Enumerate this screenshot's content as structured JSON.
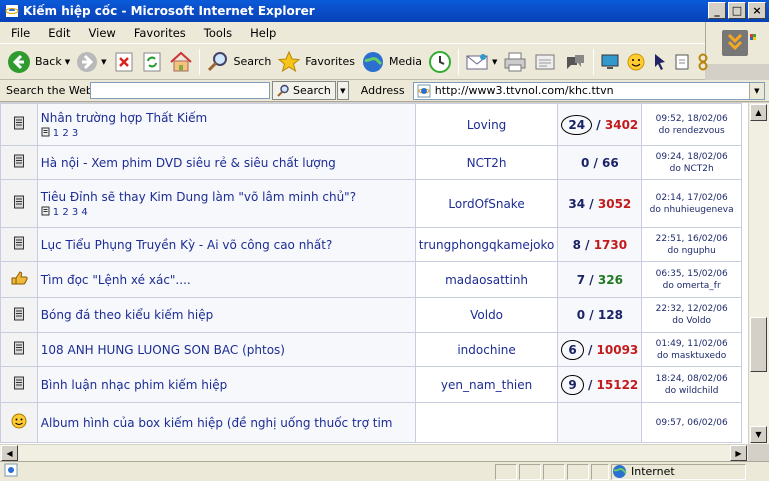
{
  "window": {
    "title": "Kiếm hiệp cốc - Microsoft Internet Explorer",
    "buttons": [
      "_",
      "□",
      "×"
    ]
  },
  "menu": [
    "File",
    "Edit",
    "View",
    "Favorites",
    "Tools",
    "Help"
  ],
  "toolbar": {
    "back_label": "Back",
    "search_label": "Search",
    "favorites_label": "Favorites",
    "media_label": "Media"
  },
  "searchbar": {
    "label": "Search the Web",
    "value": "",
    "go_label": "Search",
    "address_label": "Address",
    "url": "http://www3.ttvnol.com/khc.ttvn"
  },
  "topics": [
    {
      "title": "Nhân trường hợp Thất Kiếm",
      "pages": "1 2 3",
      "author": "Loving",
      "replies": "24",
      "views": "3402",
      "views_color": "red",
      "circled": true,
      "last_time": "09:52, 18/02/06",
      "last_by": "do rendezvous",
      "icon": "doc-icon"
    },
    {
      "title": "Hà nội - Xem phim DVD siêu rẻ & siêu chất lượng",
      "pages": "",
      "author": "NCT2h",
      "replies": "0",
      "views": "66",
      "views_color": "blue",
      "circled": false,
      "last_time": "09:24, 18/02/06",
      "last_by": "do NCT2h",
      "icon": "doc-icon"
    },
    {
      "title": "Tiêu Đỉnh sẽ thay Kim Dung làm \"võ lâm minh chủ\"?",
      "pages": "1 2 3 4",
      "author": "LordOfSnake",
      "replies": "34",
      "views": "3052",
      "views_color": "red",
      "circled": false,
      "last_time": "02:14, 17/02/06",
      "last_by": "do nhuhieugeneva",
      "icon": "doc-icon"
    },
    {
      "title": "Lục Tiểu Phụng Truyền Kỳ - Ai võ công cao nhất?",
      "pages": "",
      "author": "trungphongqkamejoko",
      "replies": "8",
      "views": "1730",
      "views_color": "red",
      "circled": false,
      "last_time": "22:51, 16/02/06",
      "last_by": "do nguphu",
      "icon": "doc-icon"
    },
    {
      "title": "Tìm đọc \"Lệnh xé xác\"....",
      "pages": "",
      "author": "madaosattinh",
      "replies": "7",
      "views": "326",
      "views_color": "green",
      "circled": false,
      "last_time": "06:35, 15/02/06",
      "last_by": "do omerta_fr",
      "icon": "thumb-icon"
    },
    {
      "title": "Bóng đá theo kiểu kiếm hiệp",
      "pages": "",
      "author": "Voldo",
      "replies": "0",
      "views": "128",
      "views_color": "blue",
      "circled": false,
      "last_time": "22:32, 12/02/06",
      "last_by": "do Voldo",
      "icon": "doc-icon"
    },
    {
      "title": "108 ANH HUNG LUONG SON BAC (phtos)",
      "pages": "",
      "author": "indochine",
      "replies": "6",
      "views": "10093",
      "views_color": "red",
      "circled": true,
      "last_time": "01:49, 11/02/06",
      "last_by": "do masktuxedo",
      "icon": "doc-icon"
    },
    {
      "title": "Bình luận nhạc phim kiếm hiệp",
      "pages": "",
      "author": "yen_nam_thien",
      "replies": "9",
      "views": "15122",
      "views_color": "red",
      "circled": true,
      "last_time": "18:24, 08/02/06",
      "last_by": "do wildchild",
      "icon": "doc-icon"
    },
    {
      "title": "Album hình của box kiếm hiệp (đề nghị uống thuốc trợ tim",
      "pages": "",
      "author": "",
      "replies": "",
      "views": "",
      "views_color": "red",
      "circled": false,
      "last_time": "09:57, 06/02/06",
      "last_by": "",
      "icon": "smiley-icon"
    }
  ],
  "status": {
    "zone": "Internet"
  }
}
